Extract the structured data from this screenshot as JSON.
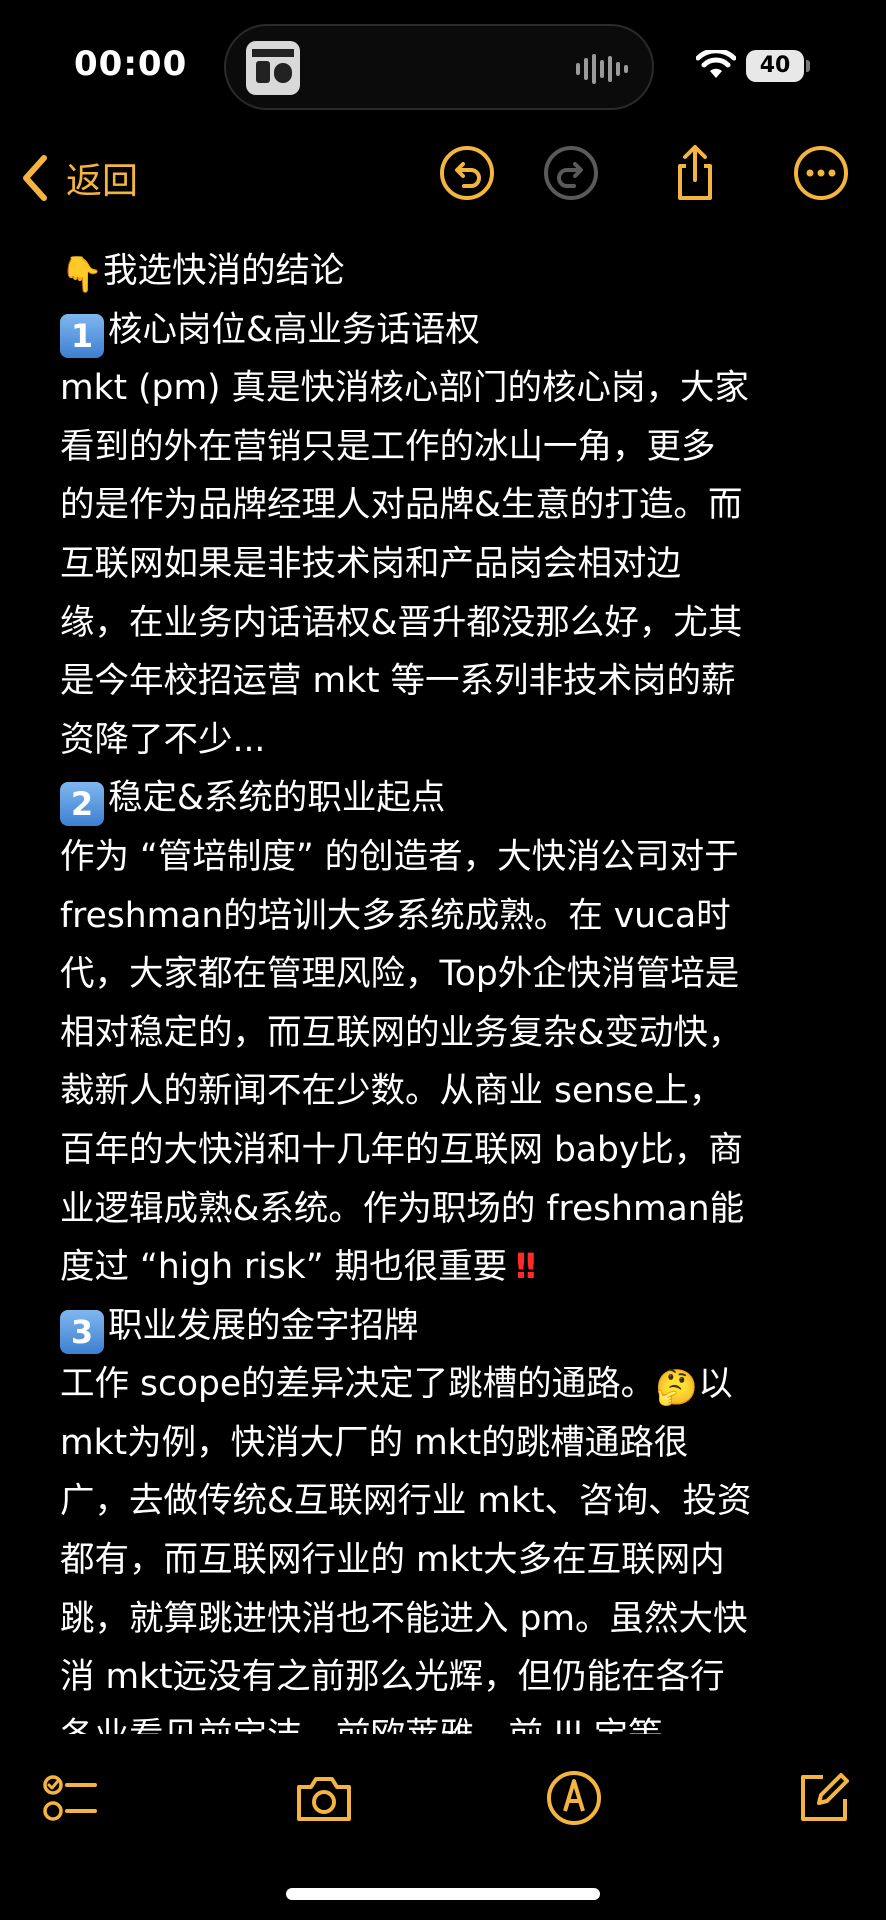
{
  "status_bar": {
    "time": "00:00",
    "battery": "40",
    "icons": [
      "media-thumbnail-icon",
      "audio-waveform-icon",
      "wifi-icon",
      "battery-icon"
    ]
  },
  "toolbar": {
    "back_label": "返回",
    "icons": [
      "chevron-left-icon",
      "undo-icon",
      "redo-icon",
      "share-icon",
      "more-icon"
    ]
  },
  "note": {
    "lines": [
      {
        "emoji": "👇",
        "text": "我选快消的结论"
      },
      {
        "keycap": "1",
        "text": "核心岗位&高业务话语权"
      },
      {
        "text": "mkt (pm) 真是快消核心部门的核心岗，大家"
      },
      {
        "text": "看到的外在营销只是工作的冰山一角，更多"
      },
      {
        "text": "的是作为品牌经理人对品牌&生意的打造。而"
      },
      {
        "text": "互联网如果是非技术岗和产品岗会相对边"
      },
      {
        "text": "缘，在业务内话语权&晋升都没那么好，尤其"
      },
      {
        "text": "是今年校招运营 mkt 等一系列非技术岗的薪"
      },
      {
        "text": "资降了不少..."
      },
      {
        "keycap": "2",
        "text": "稳定&系统的职业起点"
      },
      {
        "text": "作为 “管培制度” 的创造者，大快消公司对于"
      },
      {
        "text": " freshman的培训大多系统成熟。在 vuca时"
      },
      {
        "text": "代，大家都在管理风险，Top外企快消管培是"
      },
      {
        "text": "相对稳定的，而互联网的业务复杂&变动快，"
      },
      {
        "text": "裁新人的新闻不在少数。从商业 sense上，"
      },
      {
        "text": " 百年的大快消和十几年的互联网 baby比，商"
      },
      {
        "text": "业逻辑成熟&系统。作为职场的 freshman能"
      },
      {
        "text": "度过 “high risk” 期也很重要",
        "suffix": "!!"
      },
      {
        "keycap": "3",
        "text": "职业发展的金字招牌"
      },
      {
        "text": "工作 scope的差异决定了跳槽的通路。",
        "emoji_after": "🤔",
        "suffix_text": "以"
      },
      {
        "text": " mkt为例，快消大厂的 mkt的跳槽通路很"
      },
      {
        "text": "广，去做传统&互联网行业 mkt、咨询、投资"
      },
      {
        "text": "都有，而互联网行业的 mkt大多在互联网内"
      },
      {
        "text": "跳，就算跳进快消也不能进入 pm。虽然大快"
      },
      {
        "text": "消 mkt远没有之前那么光辉，但仍能在各行"
      },
      {
        "text": "各业看见前宝洁、前欧莱雅、前 lll 宝等"
      }
    ]
  },
  "bottom_toolbar": {
    "icons": [
      "checklist-icon",
      "camera-icon",
      "markup-pen-icon",
      "compose-icon"
    ]
  },
  "colors": {
    "accent": "#f4b53f",
    "background": "#000000",
    "text": "#ffffff",
    "keycap": "#4f8fdc",
    "exclamation": "#ff2a2a"
  }
}
